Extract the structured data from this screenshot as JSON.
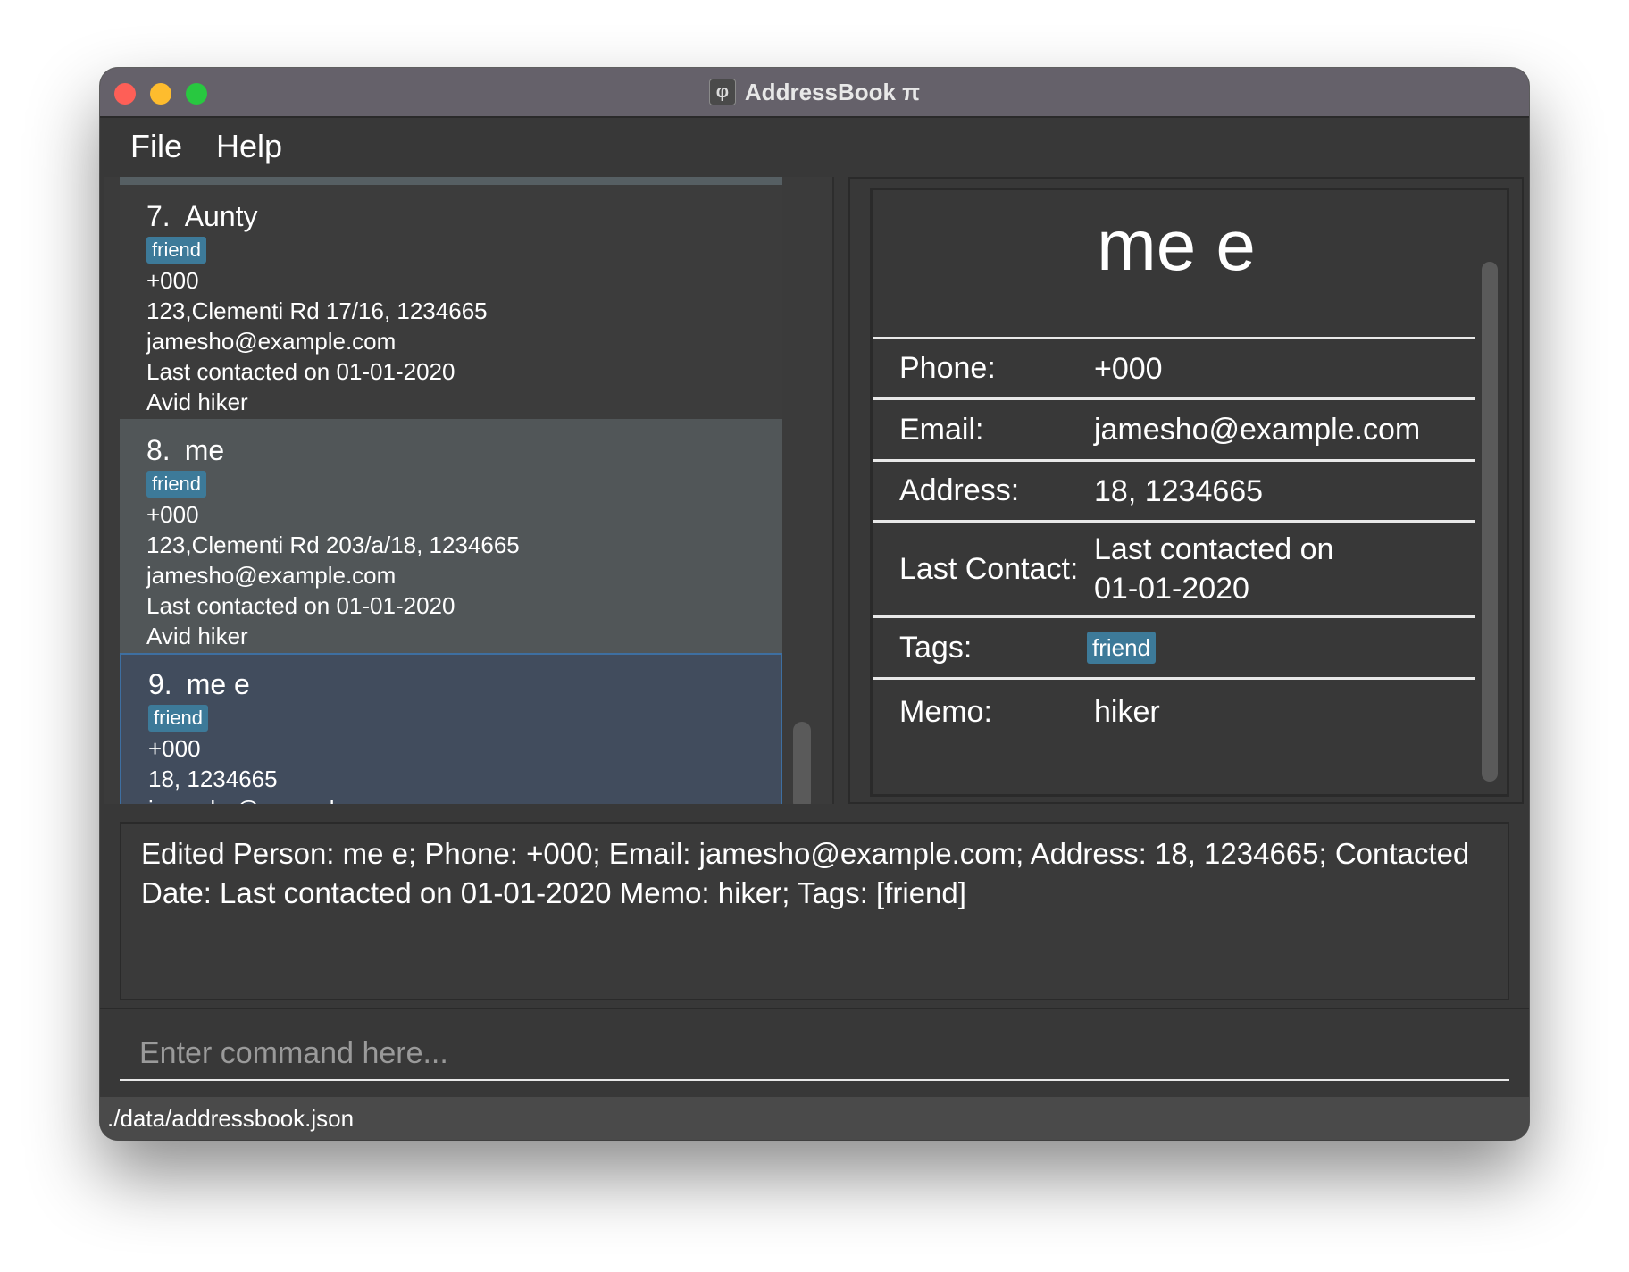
{
  "window": {
    "title": "AddressBook π",
    "icon_glyph": "φ"
  },
  "menu": {
    "file": "File",
    "help": "Help"
  },
  "persons": [
    {
      "index": "7.",
      "name": "Aunty",
      "tag": "friend",
      "phone": "+000",
      "address": "123,Clementi Rd 17/16, 1234665",
      "email": "jamesho@example.com",
      "last_contacted": "Last contacted on 01-01-2020",
      "memo": "Avid hiker"
    },
    {
      "index": "8.",
      "name": "me",
      "tag": "friend",
      "phone": "+000",
      "address": "123,Clementi Rd 203/a/18, 1234665",
      "email": "jamesho@example.com",
      "last_contacted": "Last contacted on 01-01-2020",
      "memo": "Avid hiker"
    },
    {
      "index": "9.",
      "name": "me e",
      "tag": "friend",
      "phone": "+000",
      "address": "18, 1234665",
      "email": "jamesho@example.com"
    }
  ],
  "detail": {
    "name": "me e",
    "phone_label": "Phone:",
    "phone": "+000",
    "email_label": "Email:",
    "email": "jamesho@example.com",
    "address_label": "Address:",
    "address": "18, 1234665",
    "last_contact_label": "Last Contact:",
    "last_contact_line1": "Last contacted on",
    "last_contact_line2": "01-01-2020",
    "tags_label": "Tags:",
    "tag": "friend",
    "memo_label": "Memo:",
    "memo": "hiker"
  },
  "result": {
    "text": "Edited Person: me e; Phone: +000; Email: jamesho@example.com; Address: 18, 1234665; Contacted Date: Last contacted on 01-01-2020 Memo: hiker; Tags: [friend]"
  },
  "command": {
    "placeholder": "Enter command here...",
    "value": ""
  },
  "status": {
    "path": "./data/addressbook.json"
  },
  "colors": {
    "tag_bg": "#3d7a99",
    "selected_card_bg": "#414c5d",
    "selected_card_border": "#3e6fa1"
  }
}
